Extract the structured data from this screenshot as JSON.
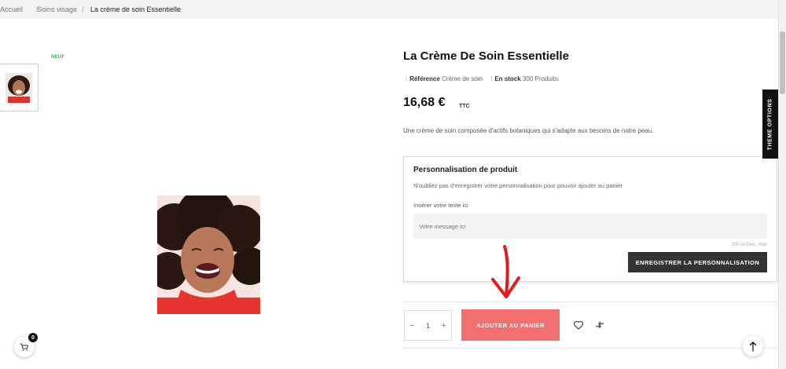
{
  "breadcrumb": {
    "items": [
      "Accueil",
      "Soins visage",
      "La crème de soin Essentielle"
    ],
    "separator": "/"
  },
  "product": {
    "badge": "NEUF",
    "title": "La Crème De Soin Essentielle",
    "reference_label": "Référence",
    "reference_value": "Crème de soin",
    "stock_label": "En stock",
    "stock_value": "300 Produits",
    "price": "16,68 €",
    "tax_label": "TTC",
    "description": "Une crème de soin composée d'actifs botaniques qui s'adapte aux besoins de notre peau."
  },
  "customization": {
    "title": "Personnalisation de produit",
    "note": "N'oubliez pas d'enregistrer votre personnalisation pour pouvoir ajouter au panier",
    "field_label": "Insérer votre texte ici",
    "placeholder": "Votre message ici",
    "char_limit": "250 ombles. max",
    "save_label": "ENREGISTRER LA PERSONNALISATION"
  },
  "purchase": {
    "quantity": "1",
    "minus": "−",
    "plus": "+",
    "add_to_cart_label": "AJOUTER AU PANIER"
  },
  "theme_options_label": "THEME OPTIONS",
  "cart": {
    "count": "0"
  },
  "colors": {
    "accent": "#f47070",
    "new_badge": "#3bb54a",
    "annotation_arrow": "#e21b1b"
  },
  "icons": [
    "heart-icon",
    "compare-icon",
    "cart-icon",
    "arrow-up-icon",
    "annotation-arrow-icon"
  ]
}
